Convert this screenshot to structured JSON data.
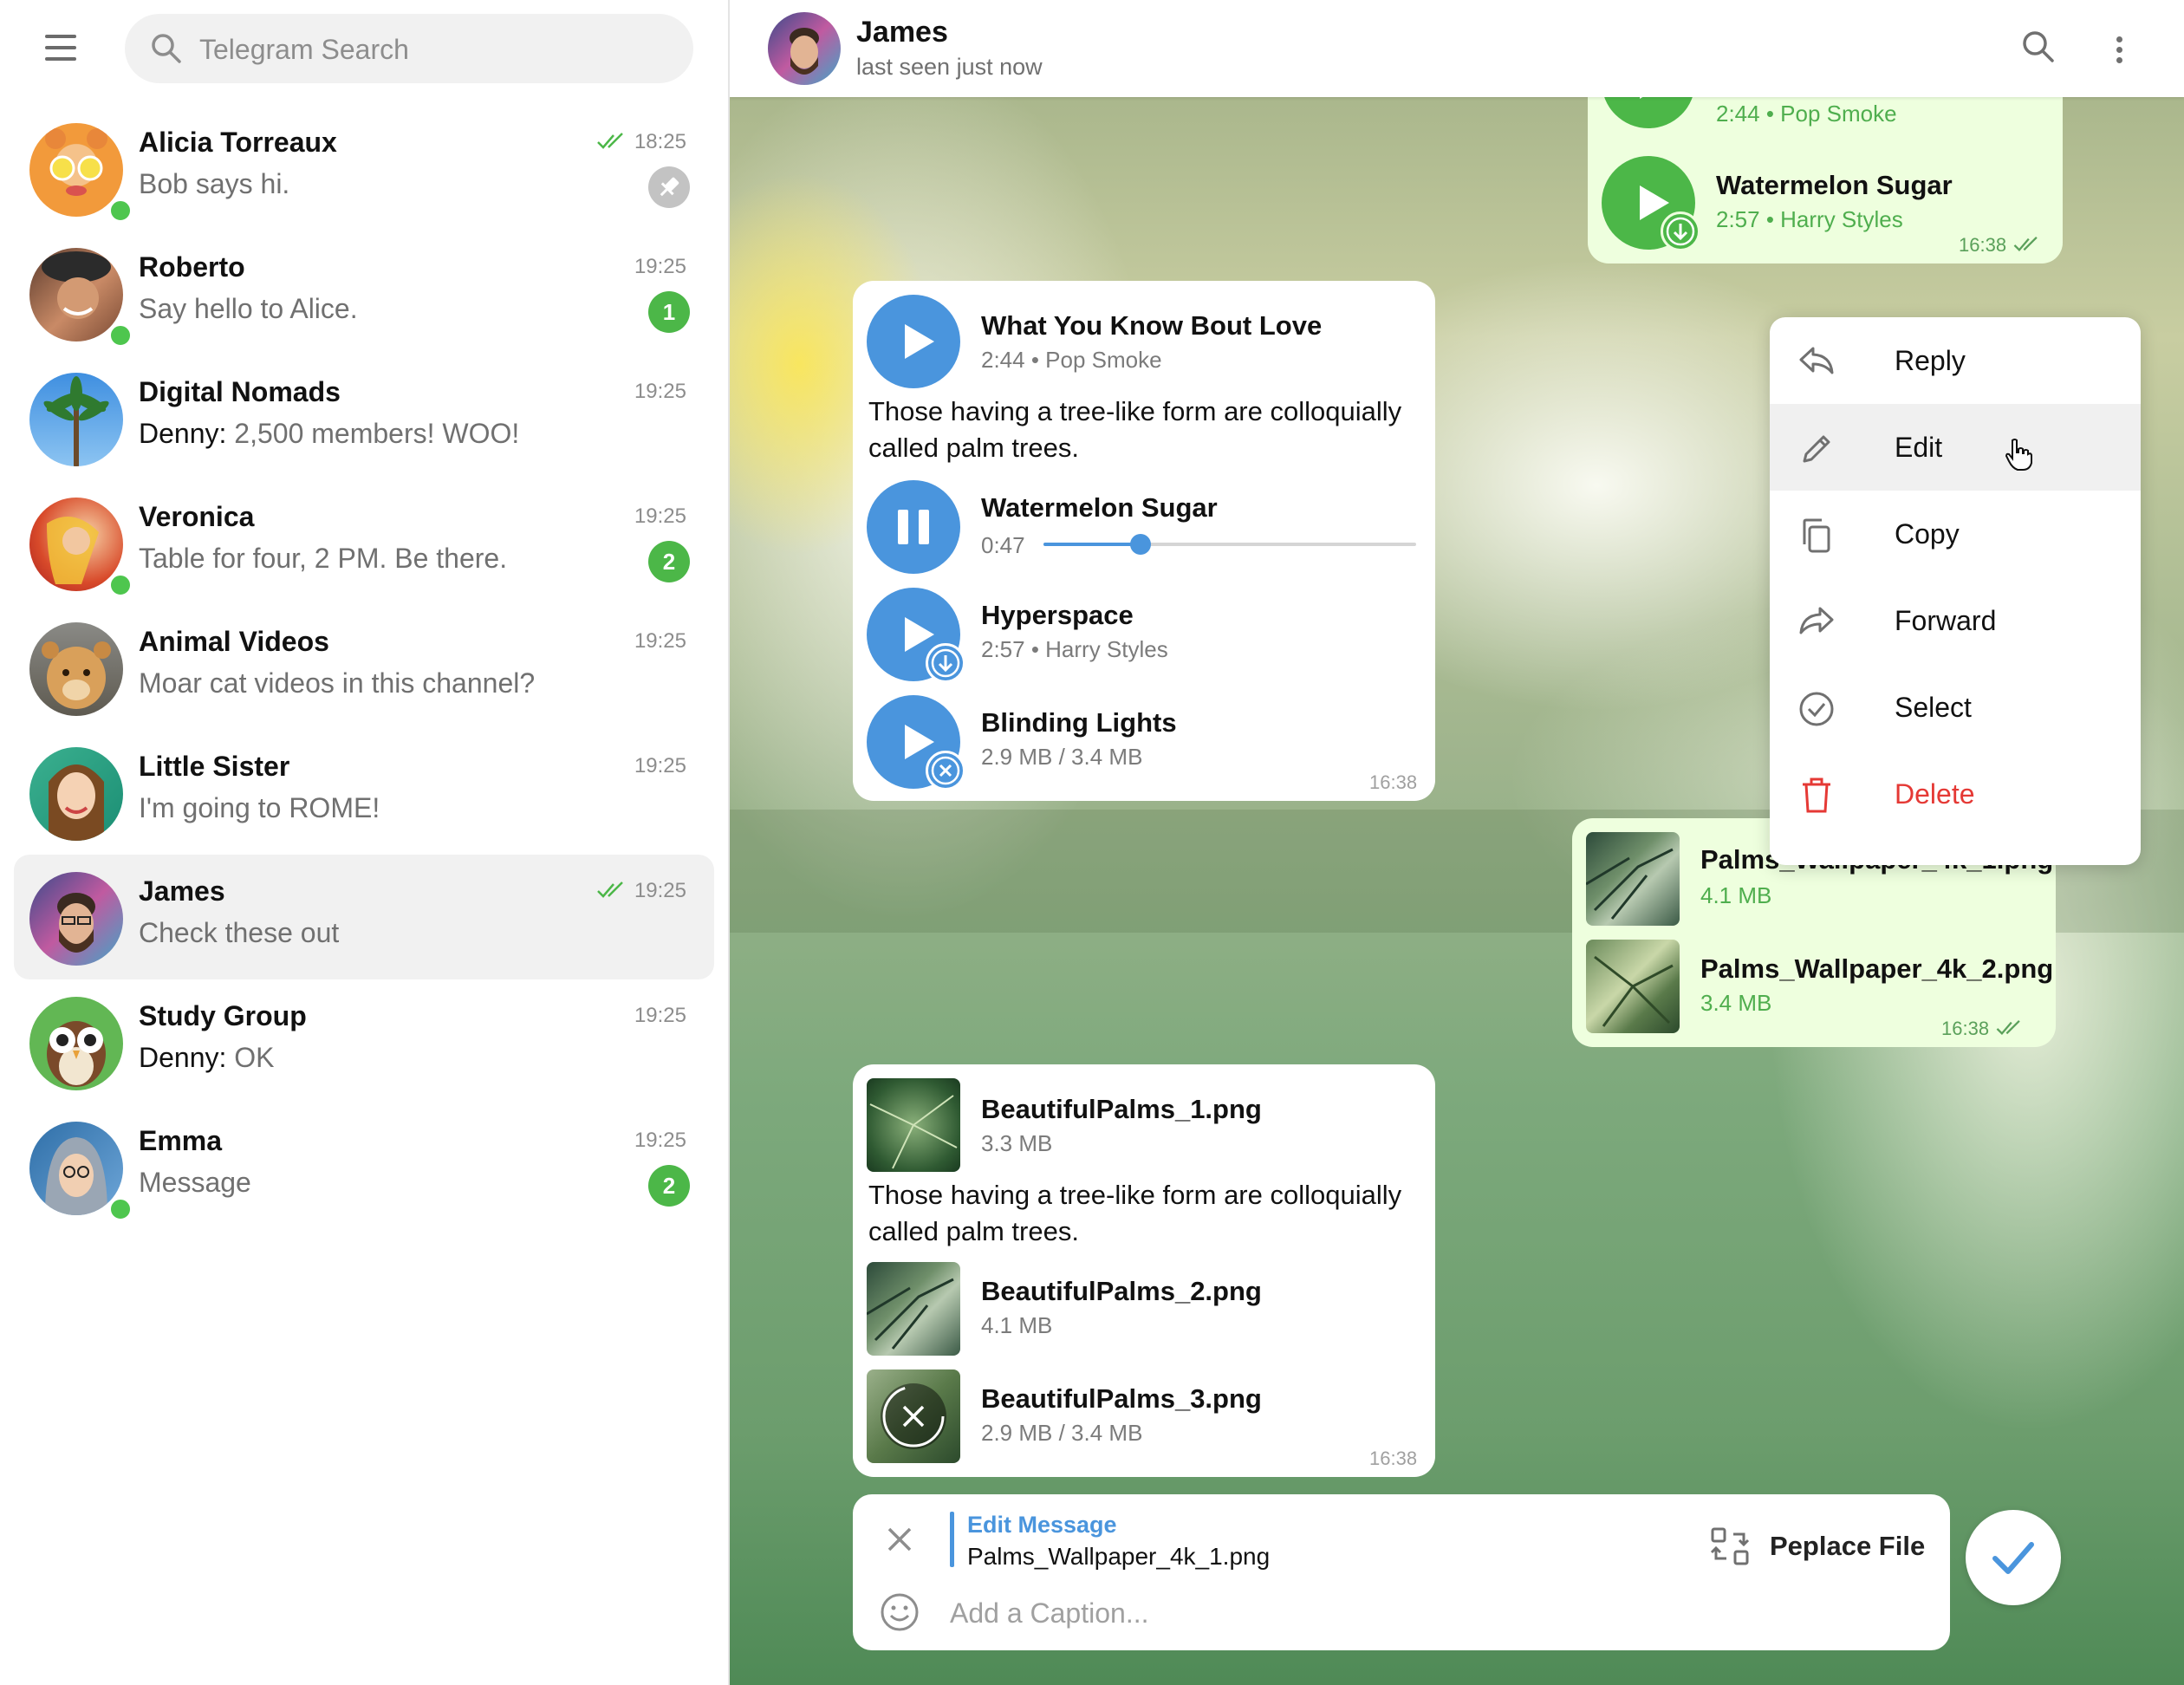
{
  "search": {
    "placeholder": "Telegram Search"
  },
  "chats": [
    {
      "name": "Alicia Torreaux",
      "message": "Bob says hi.",
      "time": "18:25",
      "read": true,
      "pinned": true,
      "online": true
    },
    {
      "name": "Roberto",
      "message": "Say hello to Alice.",
      "time": "19:25",
      "badge": "1",
      "online": true
    },
    {
      "name": "Digital Nomads",
      "sender": "Denny:",
      "message": "2,500 members! WOO!",
      "time": "19:25"
    },
    {
      "name": "Veronica",
      "message": "Table for four, 2 PM. Be there.",
      "time": "19:25",
      "badge": "2",
      "online": true
    },
    {
      "name": "Animal Videos",
      "message": "Moar cat videos in this channel?",
      "time": "19:25"
    },
    {
      "name": "Little Sister",
      "message": "I'm going to ROME!",
      "time": "19:25"
    },
    {
      "name": "James",
      "message": "Check these out",
      "time": "19:25",
      "read": true,
      "active": true
    },
    {
      "name": "Study Group",
      "sender": "Denny:",
      "message": "OK",
      "time": "19:25"
    },
    {
      "name": "Emma",
      "message": "Message",
      "time": "19:25",
      "badge": "2",
      "online": true
    }
  ],
  "header": {
    "name": "James",
    "status": "last seen just now"
  },
  "messages": {
    "top_out": {
      "track1_sub": "2:44 • Pop Smoke",
      "track2_title": "Watermelon Sugar",
      "track2_sub": "2:57 • Harry Styles",
      "time": "16:38"
    },
    "music_in": {
      "track1_title": "What You Know Bout Love",
      "track1_sub": "2:44 • Pop Smoke",
      "caption": "Those having a tree-like form are colloquially called palm trees.",
      "track2_title": "Watermelon Sugar",
      "track2_progress": "0:47",
      "track2_fraction": 0.26,
      "track3_title": "Hyperspace",
      "track3_sub": "2:57 • Harry Styles",
      "track4_title": "Blinding Lights",
      "track4_sub": "2.9 MB / 3.4 MB",
      "time": "16:38"
    },
    "files_out": {
      "file1_name": "Palms_Wallpaper_4k_1.png",
      "file1_size": "4.1 MB",
      "file2_name": "Palms_Wallpaper_4k_2.png",
      "file2_size": "3.4 MB",
      "time": "16:38"
    },
    "files_in": {
      "file1_name": "BeautifulPalms_1.png",
      "file1_size": "3.3 MB",
      "caption": "Those having a tree-like form are colloquially called palm trees.",
      "file2_name": "BeautifulPalms_2.png",
      "file2_size": "4.1 MB",
      "file3_name": "BeautifulPalms_3.png",
      "file3_size": "2.9 MB / 3.4 MB",
      "time": "16:38"
    }
  },
  "context_menu": {
    "reply": "Reply",
    "edit": "Edit",
    "copy": "Copy",
    "forward": "Forward",
    "select": "Select",
    "delete": "Delete"
  },
  "composer": {
    "edit_title": "Edit Message",
    "edit_file": "Palms_Wallpaper_4k_1.png",
    "caption_placeholder": "Add a Caption...",
    "replace_label": "Peplace File"
  },
  "colors": {
    "accent": "#4a95dd",
    "badge": "#4cb748",
    "danger": "#e53935",
    "outgoing": "#eeffde"
  }
}
